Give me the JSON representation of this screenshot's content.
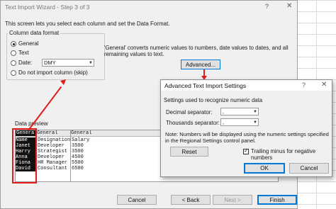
{
  "wizard": {
    "title": "Text Import Wizard - Step 3 of 3",
    "help_glyph": "?",
    "close_glyph": "✕",
    "description": "This screen lets you select each column and set the Data Format.",
    "column_format": {
      "label": "Column data format",
      "options": [
        {
          "label": "General",
          "selected": true
        },
        {
          "label": "Text",
          "selected": false
        },
        {
          "label": "Date:",
          "selected": false
        },
        {
          "label": "Do not import column (skip)",
          "selected": false
        }
      ],
      "date_value": "DMY"
    },
    "general_note": "'General' converts numeric values to numbers, date values to dates, and all remaining values to text.",
    "advanced_button": "Advanced...",
    "preview_label": "Data preview",
    "preview": {
      "headers": [
        "General",
        "General",
        "General"
      ],
      "rows": [
        [
          "Name",
          "Designation",
          "Salary"
        ],
        [
          "Janet",
          "Developer",
          "3500"
        ],
        [
          "Harry",
          "Strategist",
          "3500"
        ],
        [
          "Anna",
          "Developer",
          "4500"
        ],
        [
          "Fiona",
          "HR Manager",
          "5500"
        ],
        [
          "David",
          "Consultant",
          "6500"
        ]
      ]
    },
    "buttons": {
      "cancel": "Cancel",
      "back": "< Back",
      "next": "Next >",
      "finish": "Finish"
    }
  },
  "advanced_dialog": {
    "title": "Advanced Text Import Settings",
    "help_glyph": "?",
    "close_glyph": "✕",
    "subtitle": "Settings used to recognize numeric data",
    "decimal_label": "Decimal separator:",
    "decimal_value": ",",
    "thousands_label": "Thousands separator:",
    "thousands_value": ",",
    "note": "Note: Numbers will be displayed using the numeric settings specified in the Regional Settings control panel.",
    "reset_button": "Reset",
    "trailing_minus_label": "Trailing minus for negative numbers",
    "trailing_minus_checked": true,
    "ok_button": "OK",
    "cancel_button": "Cancel"
  },
  "colors": {
    "accent": "#0078d7",
    "highlight": "#e21b1b"
  }
}
